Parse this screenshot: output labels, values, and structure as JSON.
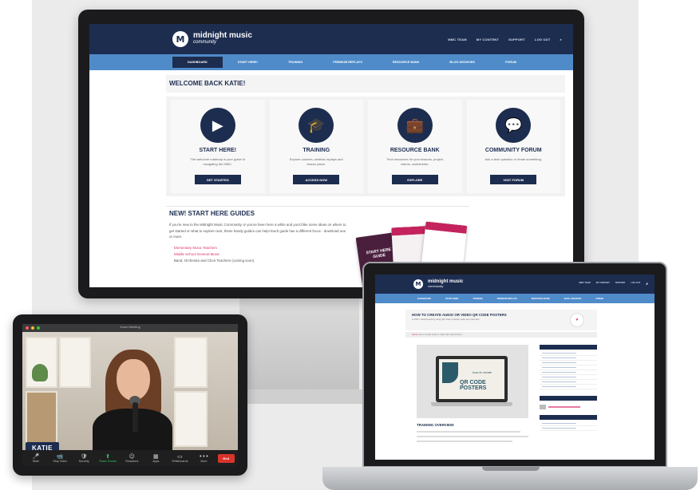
{
  "desktop": {
    "brand": {
      "mark": "M",
      "name": "midnight music",
      "sub": "community"
    },
    "top_links": [
      "MMC TEAM",
      "MY CONTENT",
      "SUPPORT",
      "LOG OUT"
    ],
    "nav": [
      "DASHBOARD",
      "START HERE!",
      "TRAINING",
      "PREMIUM REPLAYS",
      "RESOURCE BANK",
      "BLOG ARCHIVES",
      "FORUM"
    ],
    "welcome": "WELCOME BACK KATIE!",
    "cards": [
      {
        "icon": "play-icon",
        "glyph": "▶",
        "title": "START HERE!",
        "desc": "The welcome roadmap is your guide to navigating the MMC.",
        "button": "GET STARTED"
      },
      {
        "icon": "graduation-cap-icon",
        "glyph": "🎓",
        "title": "TRAINING",
        "desc": "Explore courses, webinar replays and lesson plans.",
        "button": "ACCESS NOW"
      },
      {
        "icon": "briefcase-icon",
        "glyph": "💼",
        "title": "RESOURCE BANK",
        "desc": "Tech resources for your lessons, project videos, worksheets.",
        "button": "EXPLORE"
      },
      {
        "icon": "chat-bubbles-icon",
        "glyph": "💬",
        "title": "COMMUNITY FORUM",
        "desc": "Ask a tech question or share something.",
        "button": "VISIT FORUM"
      }
    ],
    "guides": {
      "title": "NEW! START HERE GUIDES",
      "text": "If you're new to the Midnight Music Community or you've been here a while and you'd like some ideas on where to get started or what to explore next, these handy guides can help! Each guide has a different focus - download one or more.",
      "items": [
        "Elementary Music Teachers",
        "Middle School General Music",
        "Band, Orchestra and Choir Teachers (coming soon)"
      ],
      "poster_text": "START HERE GUIDE"
    }
  },
  "tablet": {
    "window_title": "Zoom Meeting",
    "name_tag": "KATIE",
    "controls": [
      {
        "icon": "microphone-icon",
        "glyph": "🎤",
        "label": "Mute"
      },
      {
        "icon": "video-camera-icon",
        "glyph": "📹",
        "label": "Stop Video"
      },
      {
        "icon": "shield-icon",
        "glyph": "🛡",
        "label": "Security"
      },
      {
        "icon": "share-screen-icon",
        "glyph": "⬆",
        "label": "Share Screen"
      },
      {
        "icon": "reactions-icon",
        "glyph": "☺",
        "label": "Reactions"
      },
      {
        "icon": "apps-icon",
        "glyph": "▦",
        "label": "Apps"
      },
      {
        "icon": "whiteboard-icon",
        "glyph": "▭",
        "label": "Whiteboards"
      },
      {
        "icon": "more-icon",
        "glyph": "•••",
        "label": "More"
      }
    ],
    "end_label": "End"
  },
  "laptop": {
    "brand": {
      "mark": "M",
      "name": "midnight music",
      "sub": "community"
    },
    "top_links": [
      "MMC TEAM",
      "MY CONTENT",
      "SUPPORT",
      "LOG OUT"
    ],
    "nav": [
      "DASHBOARD",
      "START HERE",
      "TRAINING",
      "PREMIUM REPLAYS",
      "RESOURCE BANK",
      "BLOG ARCHIVES",
      "FORUM"
    ],
    "page_title": "HOW TO CREATE AUDIO OR VIDEO QR CODE POSTERS",
    "page_sub": "In 2021 I started teaching using QR codes to display audio and video files.",
    "heart_glyph": "♥",
    "crumb_home": "Home",
    "crumb_rest": "How to Create Audio or Video QR Code Posters",
    "hero_script": "how to create",
    "hero_text": "QR CODE POSTERS",
    "overview": "TRAINING OVERVIEW:"
  }
}
